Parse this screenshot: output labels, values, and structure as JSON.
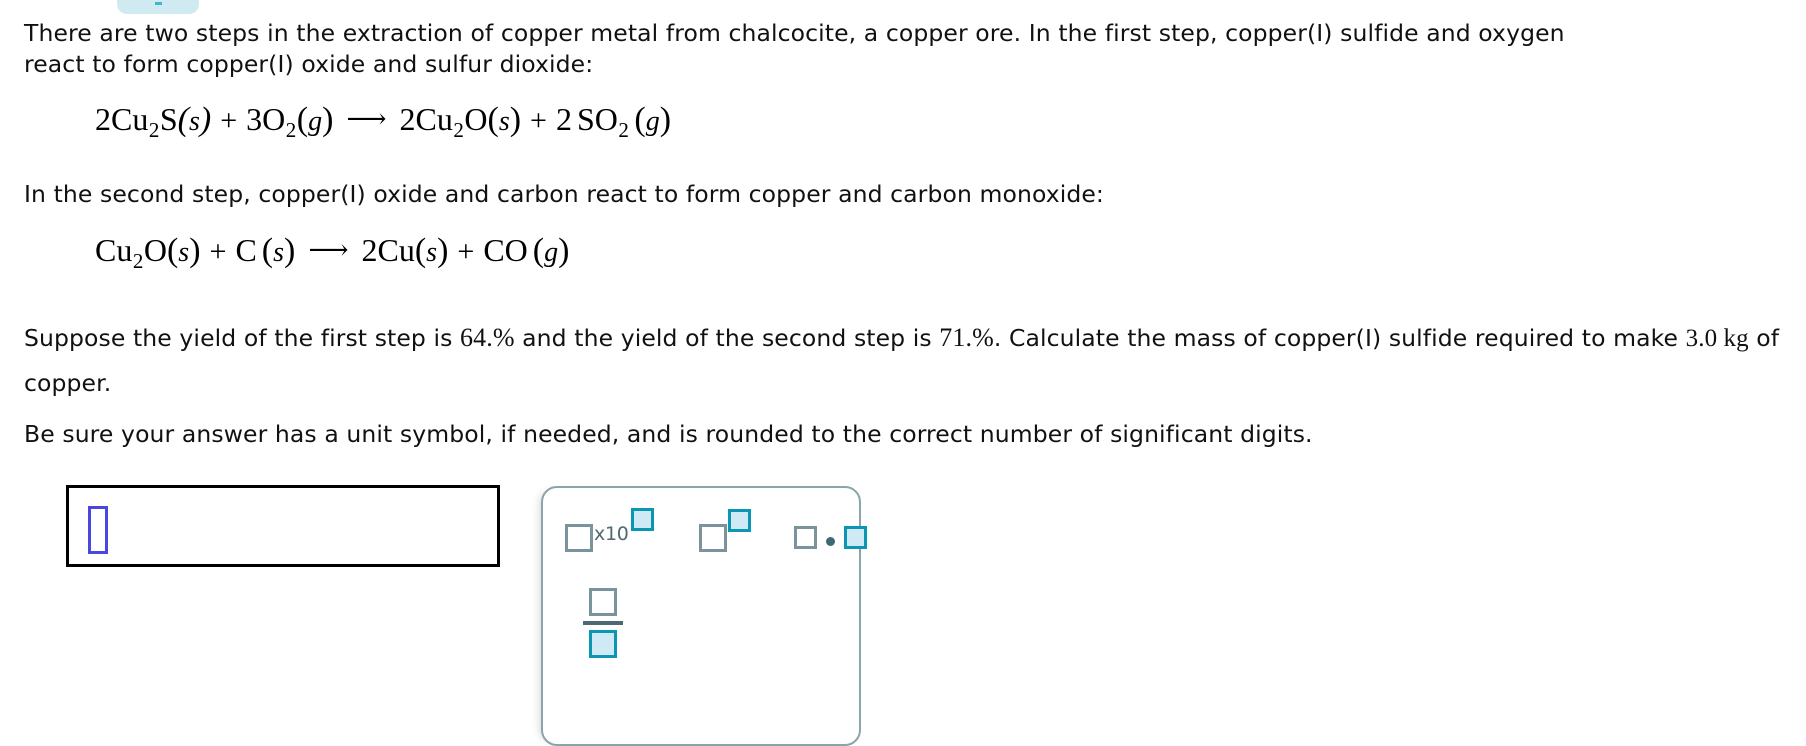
{
  "problem": {
    "intro": "There are two steps in the extraction of copper metal from chalcocite, a copper ore. In the first step, copper(I) sulfide and oxygen react to form copper(I) oxide and sulfur dioxide:",
    "second_step_text": "In the second step, copper(I) oxide and carbon react to form copper and carbon monoxide:",
    "suppose_prefix": "Suppose the yield of the first step is ",
    "yield_first": "64.%",
    "suppose_mid": " and the yield of the second step is ",
    "yield_second": "71.%",
    "suppose_suffix": ". Calculate the mass of copper(I) sulfide required to make ",
    "mass_value": "3.0 kg",
    "suppose_end": " of copper.",
    "be_sure": "Be sure your answer has a unit symbol, if needed, and is rounded to the correct number of significant digits."
  },
  "equations": {
    "first": {
      "text": "2Cu2S(s) + 3O2(g) → 2Cu2O(s) + 2 SO2 (g)",
      "terms": [
        {
          "coef": "2",
          "formula": "Cu",
          "sub": "2",
          "formula2": "S",
          "state": "s"
        },
        {
          "coef": "3",
          "formula": "O",
          "sub": "2",
          "state": "g"
        },
        {
          "coef": "2",
          "formula": "Cu",
          "sub": "2",
          "formula2": "O",
          "state": "s"
        },
        {
          "coef": "2",
          "formula": "SO",
          "sub": "2",
          "state": "g"
        }
      ]
    },
    "second": {
      "text": "Cu2O(s) + C(s) → 2Cu(s) + CO(g)",
      "terms": [
        {
          "coef": "",
          "formula": "Cu",
          "sub": "2",
          "formula2": "O",
          "state": "s"
        },
        {
          "coef": "",
          "formula": "C",
          "sub": "",
          "state": "s"
        },
        {
          "coef": "2",
          "formula": "Cu",
          "sub": "",
          "state": "s"
        },
        {
          "coef": "",
          "formula": "CO",
          "sub": "",
          "state": "g"
        }
      ]
    },
    "arrow": "→",
    "plus": "+"
  },
  "answer_field": {
    "value": "",
    "placeholder": ""
  },
  "math_palette": {
    "buttons": [
      {
        "name": "scientific-notation",
        "label": "x10"
      },
      {
        "name": "superscript",
        "label": ""
      },
      {
        "name": "multiply",
        "label": ""
      },
      {
        "name": "fraction",
        "label": ""
      }
    ]
  },
  "colors": {
    "teal_border": "#0b96b4",
    "teal_fill": "#cfeaf4",
    "gray_box": "#7b949c",
    "panel_border": "#8aa4ab",
    "cursor_blue": "#4a46e0",
    "top_pill": "#cfeaf0"
  }
}
